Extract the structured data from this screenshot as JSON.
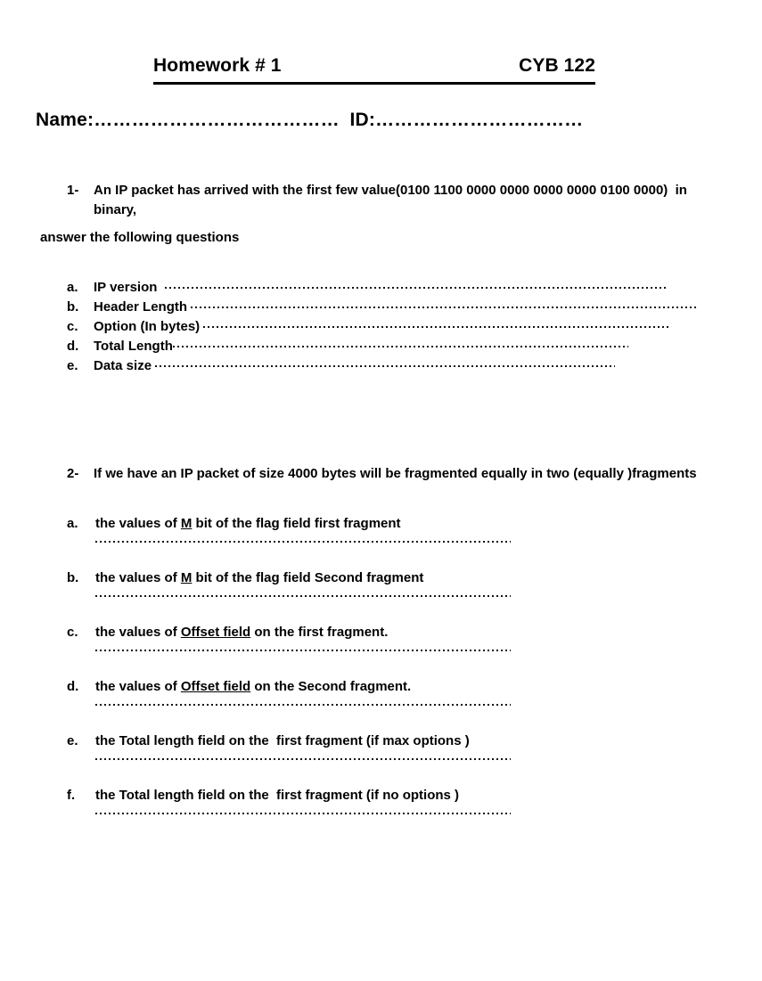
{
  "header": {
    "title": "Homework # 1",
    "course": "CYB 122"
  },
  "identity": {
    "name_label": "Name:",
    "name_dots": "…………………………………",
    "spacer": "  ",
    "id_label": "ID:",
    "id_dots": "……………………………"
  },
  "questions": [
    {
      "number": "1-",
      "text": "An IP packet has arrived with the first few value(0100 1100 0000 0000 0000 0000 0100 0000)  in binary,",
      "continuation": "answer the following questions",
      "items": [
        {
          "marker": "a.",
          "label": "IP version  "
        },
        {
          "marker": "b.",
          "label": "Header Length "
        },
        {
          "marker": "c.",
          "label": "Option (In bytes) "
        },
        {
          "marker": "d.",
          "label": "Total Length"
        },
        {
          "marker": "e.",
          "label": "Data size "
        }
      ]
    },
    {
      "number": "2-",
      "text": "If we have an IP packet of size 4000 bytes will be fragmented equally in two (equally )fragments",
      "items": [
        {
          "marker": "a.",
          "prefix": "the values of ",
          "emphasis": "M",
          "suffix": " bit of the flag field first fragment"
        },
        {
          "marker": "b.",
          "prefix": "the values of ",
          "emphasis": "M",
          "suffix": " bit of the flag field Second fragment"
        },
        {
          "marker": "c.",
          "prefix": "the values of ",
          "emphasis": "Offset field",
          "suffix": " on the first fragment."
        },
        {
          "marker": "d.",
          "prefix": "the values of ",
          "emphasis": "Offset field",
          "suffix": " on the Second fragment."
        },
        {
          "marker": "e.",
          "prefix": "the Total length field on the  first fragment (if max options )",
          "emphasis": "",
          "suffix": ""
        },
        {
          "marker": "f.",
          "prefix": "the Total length field on the  first fragment (if no options )",
          "emphasis": "",
          "suffix": ""
        }
      ]
    }
  ]
}
